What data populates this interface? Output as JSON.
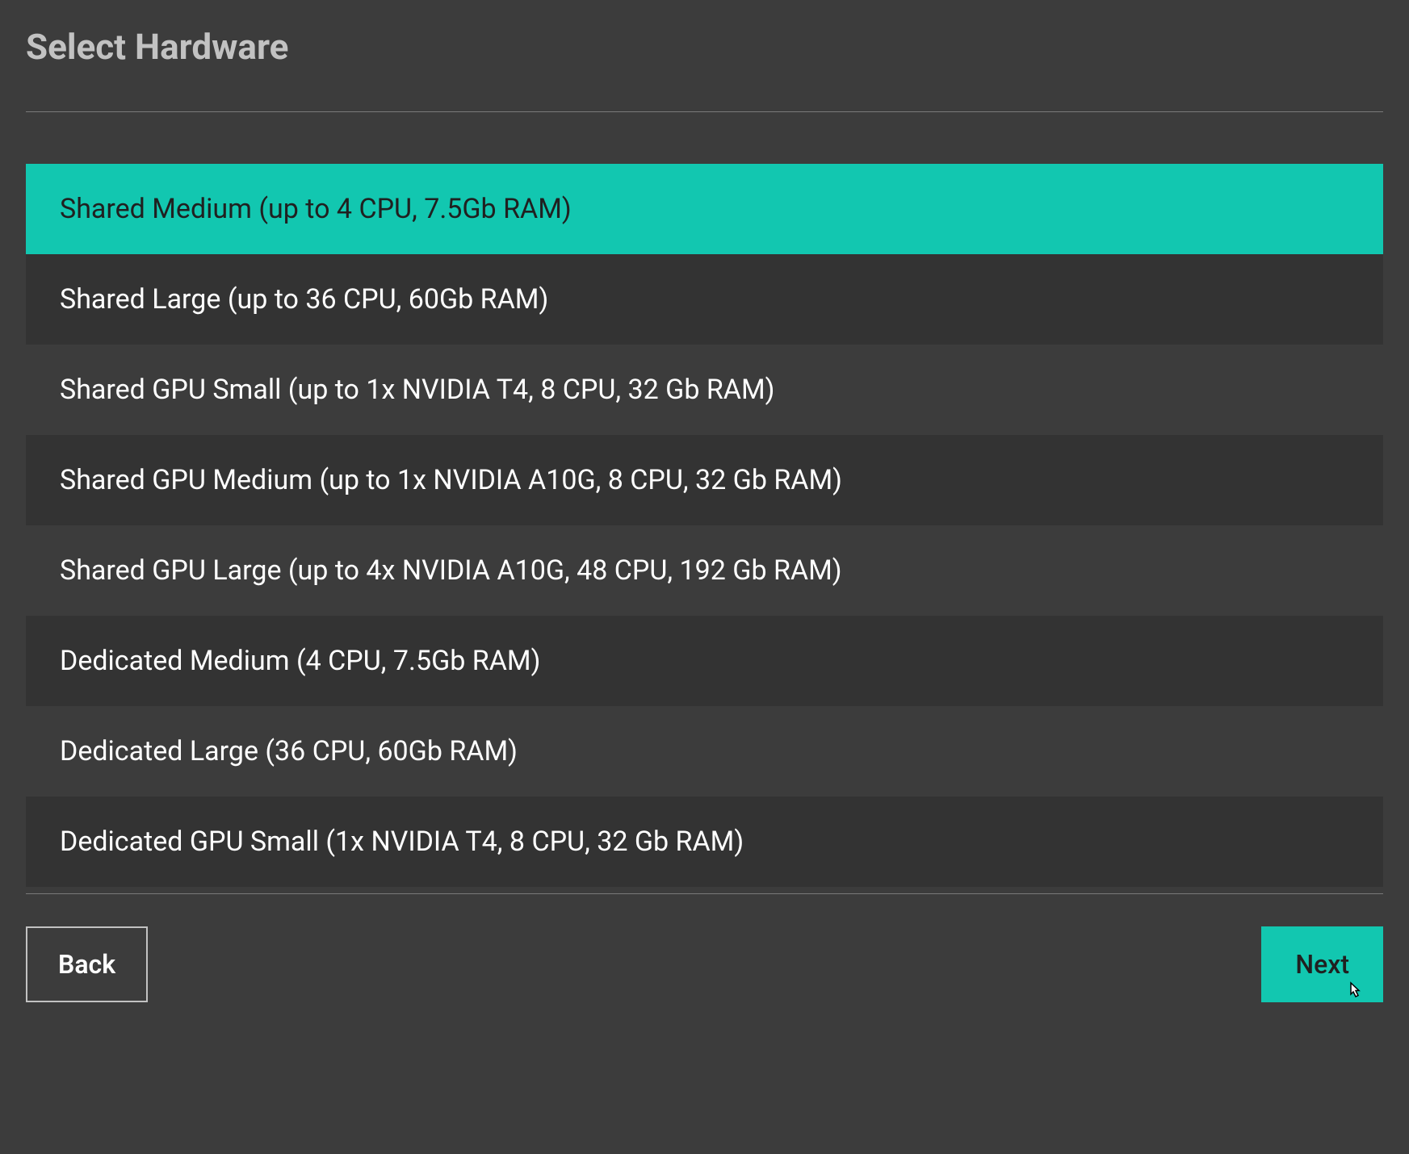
{
  "header": {
    "title": "Select Hardware"
  },
  "hardware_options": [
    {
      "label": "Shared Medium (up to 4 CPU, 7.5Gb RAM)",
      "selected": true
    },
    {
      "label": "Shared Large (up to 36 CPU, 60Gb RAM)",
      "selected": false
    },
    {
      "label": "Shared GPU Small (up to 1x NVIDIA T4, 8 CPU, 32 Gb RAM)",
      "selected": false
    },
    {
      "label": "Shared GPU Medium (up to 1x NVIDIA A10G, 8 CPU, 32 Gb RAM)",
      "selected": false
    },
    {
      "label": "Shared GPU Large (up to 4x NVIDIA A10G, 48 CPU, 192 Gb RAM)",
      "selected": false
    },
    {
      "label": "Dedicated Medium (4 CPU, 7.5Gb RAM)",
      "selected": false
    },
    {
      "label": "Dedicated Large (36 CPU, 60Gb RAM)",
      "selected": false
    },
    {
      "label": "Dedicated GPU Small (1x NVIDIA T4, 8 CPU, 32 Gb RAM)",
      "selected": false
    }
  ],
  "buttons": {
    "back_label": "Back",
    "next_label": "Next"
  },
  "colors": {
    "accent": "#12c7b0",
    "background_dark": "#3c3c3c",
    "background_darker": "#333333"
  }
}
